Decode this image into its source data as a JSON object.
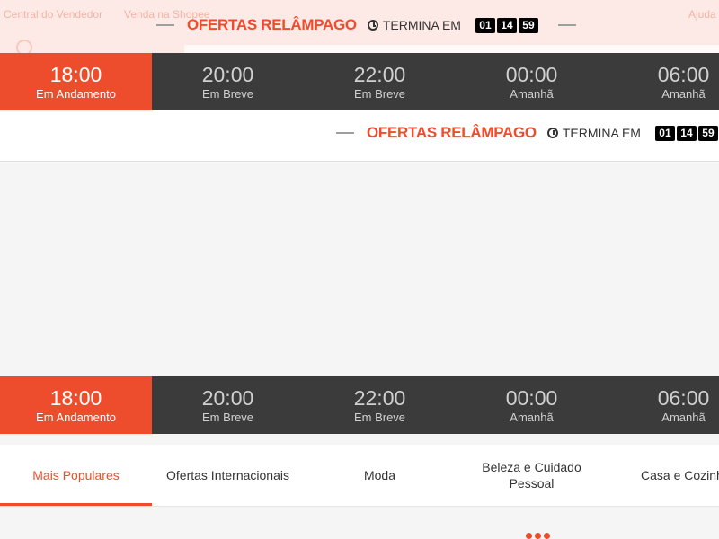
{
  "header_ghost": {
    "seller_center": "Central do Vendedor",
    "sell": "Venda na Shopee",
    "right_text": "Ajuda"
  },
  "flash": {
    "title": "OFERTAS RELÂMPAGO",
    "ends_label": "TERMINA EM",
    "countdown": {
      "hours": "01",
      "minutes": "14",
      "seconds": "59"
    }
  },
  "time_slots": [
    {
      "time": "18:00",
      "status": "Em Andamento",
      "active": true
    },
    {
      "time": "20:00",
      "status": "Em Breve",
      "active": false
    },
    {
      "time": "22:00",
      "status": "Em Breve",
      "active": false
    },
    {
      "time": "00:00",
      "status": "Amanhã",
      "active": false
    },
    {
      "time": "06:00",
      "status": "Amanhã",
      "active": false
    }
  ],
  "categories": [
    {
      "label": "Mais Populares",
      "active": true
    },
    {
      "label": "Ofertas Internacionais",
      "active": false
    },
    {
      "label": "Moda",
      "active": false
    },
    {
      "label": "Beleza e Cuidado Pessoal",
      "active": false
    },
    {
      "label": "Casa e Cozinha",
      "active": false
    }
  ],
  "colors": {
    "accent": "#ee4d2d",
    "tab_bar": "#3b3b3b",
    "countdown_bg": "#000000"
  }
}
